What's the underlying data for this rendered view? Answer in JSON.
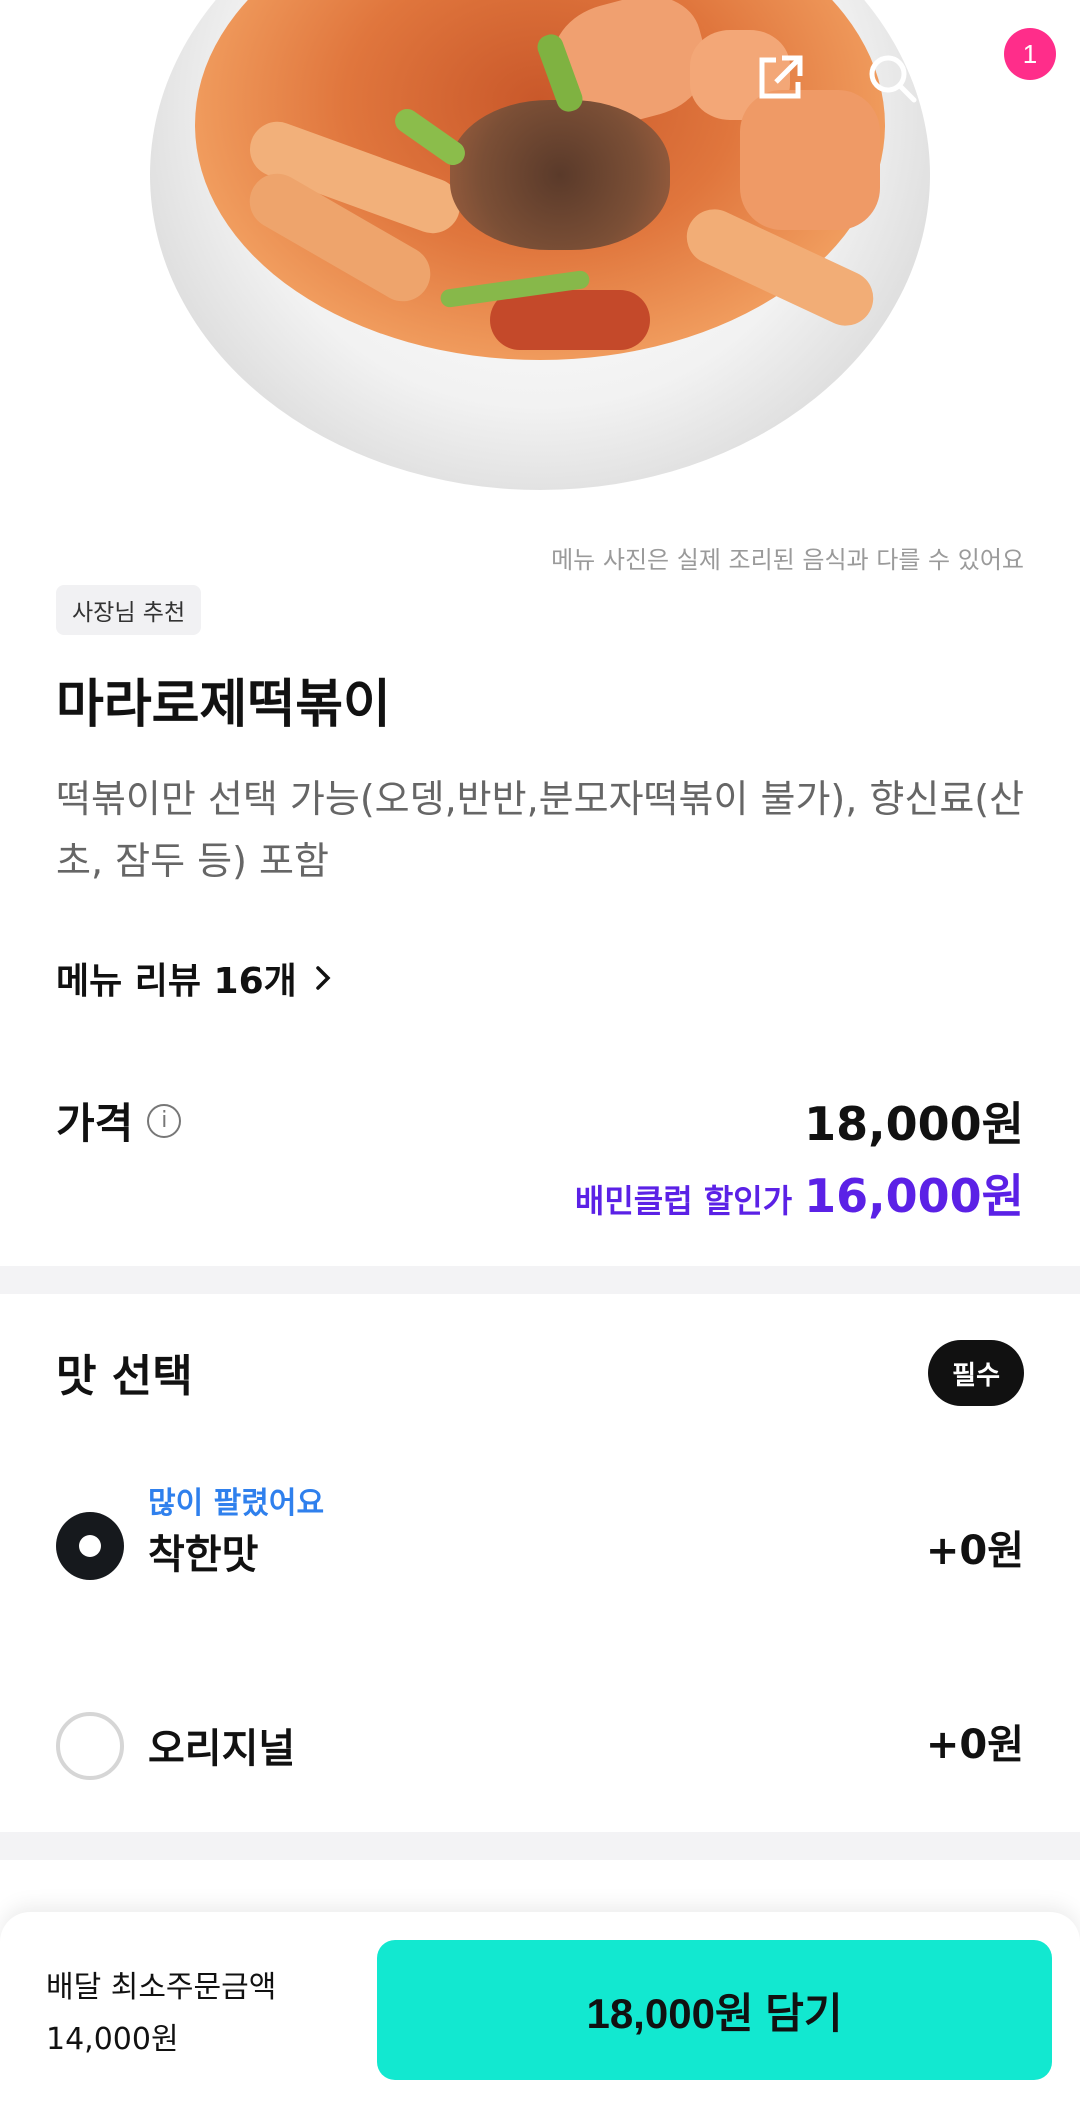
{
  "hero": {
    "image_alt": "메뉴 사진"
  },
  "nav": {
    "back_icon": "back-arrow-icon",
    "share_icon": "share-icon",
    "search_icon": "search-icon",
    "cart_icon": "cart-icon",
    "cart_count": "1"
  },
  "disclaimer": "메뉴 사진은 실제 조리된 음식과 다를 수 있어요",
  "tag": "사장님 추천",
  "menu": {
    "title": "마라로제떡볶이",
    "description": "떡볶이만 선택 가능(오뎅,반반,분모자떡볶이 불가), 향신료(산초, 잠두 등) 포함",
    "review_link": "메뉴 리뷰 16개"
  },
  "price": {
    "label": "가격",
    "value": "18,000원",
    "club_label": "배민클럽 할인가",
    "club_value": "16,000원"
  },
  "flavor": {
    "title": "맛 선택",
    "required": "필수",
    "options": [
      {
        "badge": "많이 팔렸어요",
        "label": "착한맛",
        "price": "+0원",
        "selected": true
      },
      {
        "badge": "",
        "label": "오리지널",
        "price": "+0원",
        "selected": false
      }
    ]
  },
  "bottom": {
    "min_order_label": "배달 최소주문금액",
    "min_order_value": "14,000원",
    "add_button": "18,000원 담기"
  },
  "colors": {
    "accent_mint": "#12e8d0",
    "club_purple": "#5b21e6",
    "badge_blue": "#2f80ed",
    "cart_badge_pink": "#ff2d8a"
  }
}
